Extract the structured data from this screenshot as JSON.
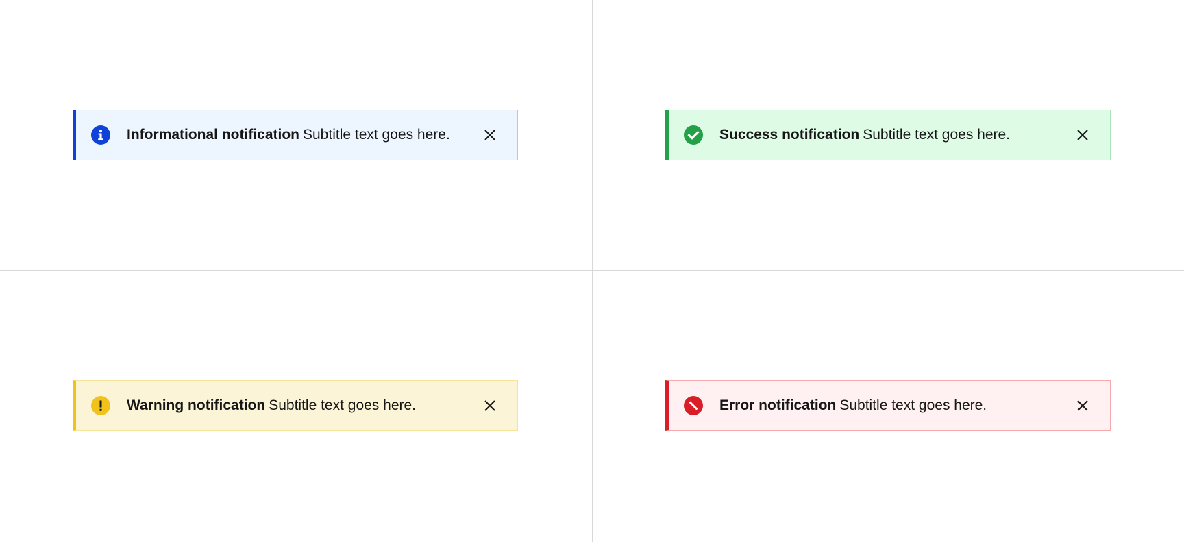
{
  "colors": {
    "info_accent": "#0f43d8",
    "success_accent": "#24a148",
    "warning_accent": "#f1c21b",
    "error_accent": "#da1e28"
  },
  "notifications": [
    {
      "kind": "info",
      "icon": "info-icon",
      "title": "Informational notification",
      "subtitle": "Subtitle text goes here.",
      "close_icon": "close-icon"
    },
    {
      "kind": "success",
      "icon": "checkmark-icon",
      "title": "Success notification",
      "subtitle": "Subtitle text goes here.",
      "close_icon": "close-icon"
    },
    {
      "kind": "warning",
      "icon": "warning-icon",
      "title": "Warning notification",
      "subtitle": "Subtitle text goes here.",
      "close_icon": "close-icon"
    },
    {
      "kind": "error",
      "icon": "error-icon",
      "title": "Error notification",
      "subtitle": "Subtitle text goes here.",
      "close_icon": "close-icon"
    }
  ]
}
